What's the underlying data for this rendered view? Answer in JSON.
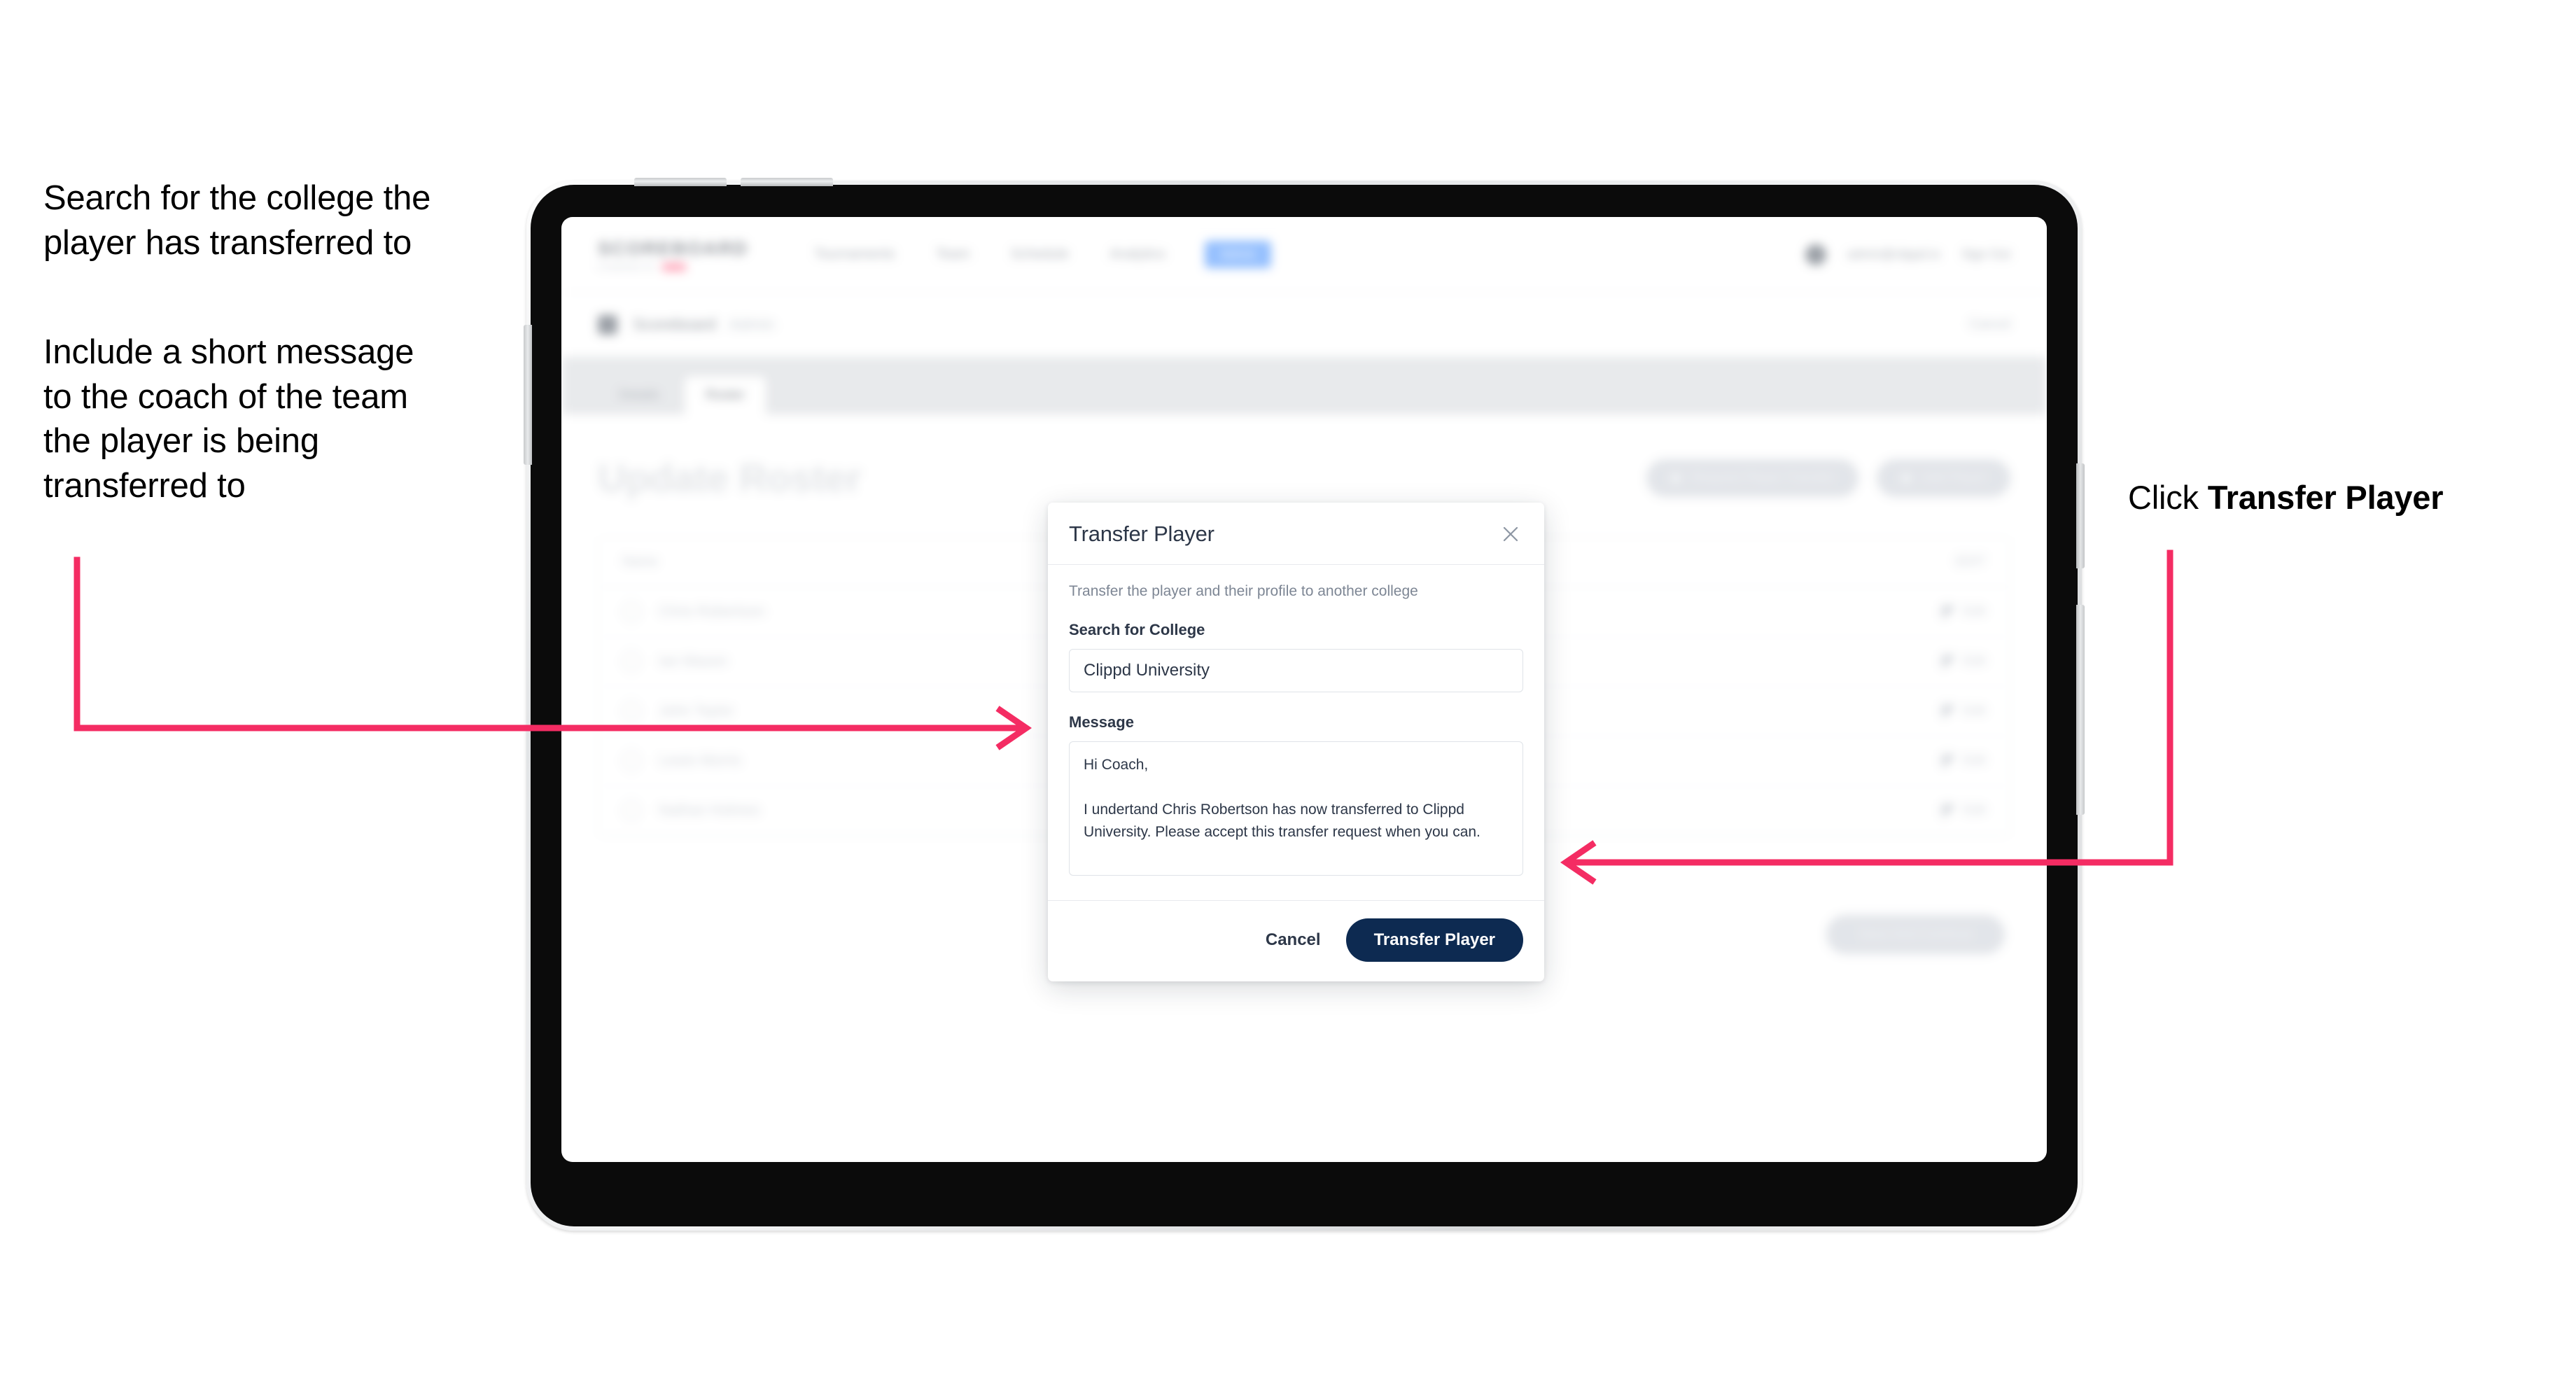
{
  "annotations": {
    "left_1": "Search for the college the\nplayer has transferred to",
    "left_2": "Include a short message\nto the coach of the team\nthe player is being\ntransferred to",
    "right_prefix": "Click ",
    "right_bold": "Transfer Player",
    "arrow_color": "#F42C63"
  },
  "app": {
    "brand": {
      "mark": "SCOREBOARD",
      "sub": "POWERED BY"
    },
    "nav": {
      "links": [
        {
          "label": "Tournaments",
          "active": false
        },
        {
          "label": "Team",
          "active": false
        },
        {
          "label": "Schedule",
          "active": false
        },
        {
          "label": "Analytics",
          "active": false
        }
      ],
      "pill": "Admin",
      "user": "admin@clippd.io",
      "signout": "Sign Out"
    },
    "subbar": {
      "title": "Scoreboard",
      "muted": "Admin",
      "right": "Cancel"
    },
    "tabs": [
      {
        "label": "Details",
        "active": false
      },
      {
        "label": "Roster",
        "active": true
      }
    ],
    "page_title": "Update Roster",
    "head_actions": [
      "Request Player Transfer",
      "Add Player"
    ],
    "roster": {
      "col_name": "Name",
      "col_edit": "EDIT",
      "rows": [
        {
          "name": "Chris Robertson",
          "edit": "Edit"
        },
        {
          "name": "Ian Mason",
          "edit": "Edit"
        },
        {
          "name": "John Taylor",
          "edit": "Edit"
        },
        {
          "name": "Lewis Morris",
          "edit": "Edit"
        },
        {
          "name": "Nathan Holmes",
          "edit": "Edit"
        }
      ]
    },
    "save_button": "Save And Continue"
  },
  "modal": {
    "title": "Transfer Player",
    "close_icon": "close-icon",
    "description": "Transfer the player and their profile to another college",
    "college_label": "Search for College",
    "college_value": "Clippd University",
    "college_placeholder": "Search for College",
    "message_label": "Message",
    "message_value": "Hi Coach,\n\nI undertand Chris Robertson has now transferred to Clippd University. Please accept this transfer request when you can.",
    "message_placeholder": "Message",
    "cancel_label": "Cancel",
    "submit_label": "Transfer Player",
    "submit_color": "#0D2A51"
  }
}
